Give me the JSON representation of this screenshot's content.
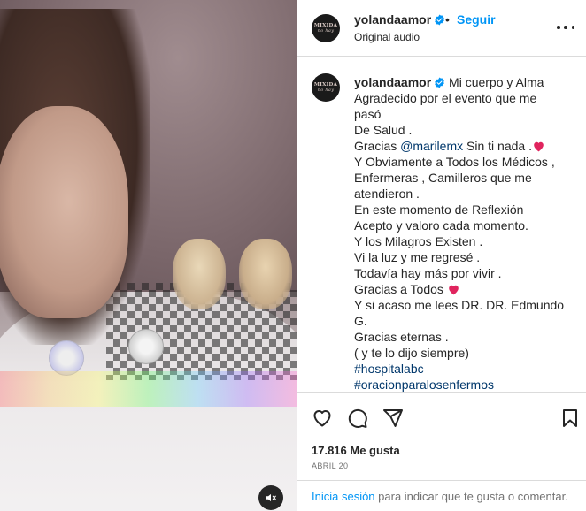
{
  "header": {
    "username": "yolandaamor",
    "dot": "•",
    "follow_label": "Seguir",
    "audio_label": "Original audio"
  },
  "avatar": {
    "line1": "MIXIDA",
    "line2": "no hay"
  },
  "caption": {
    "username": "yolandaamor",
    "lines": [
      "Mi cuerpo y Alma",
      "Agradecido por el evento que me pasó",
      "De Salud .",
      "Gracias",
      "Y Obviamente a Todos los Médicos , Enfermeras , Camilleros que me atendieron .",
      "En este momento de Reflexión",
      "Acepto y valoro cada momento.",
      "Y los Milagros Existen .",
      "Vi la luz y me regresé .",
      "Todavía hay más por vivir .",
      "Gracias a Todos",
      "Y si acaso me lees DR. DR. Edmundo G.",
      "Gracias eternas .",
      "( y te lo dijo siempre)"
    ],
    "mention": "@marilemx",
    "mention_suffix": " Sin ti nada .",
    "hashtags": [
      "#hospitalabc",
      "#oracionparalosenfermos"
    ]
  },
  "stats": {
    "likes": "17.816 Me gusta",
    "date": "ABRIL 20"
  },
  "login": {
    "link": "Inicia sesión",
    "text": " para indicar que te gusta o comentar."
  },
  "icons": {
    "verified": "verified-badge-icon",
    "more": "more-options-icon",
    "like": "heart-icon",
    "comment": "comment-icon",
    "share": "share-icon",
    "save": "bookmark-icon",
    "mute": "muted-speaker-icon"
  },
  "colors": {
    "link_blue": "#0095f6",
    "mention": "#00376b",
    "heart": "#ed4956"
  }
}
